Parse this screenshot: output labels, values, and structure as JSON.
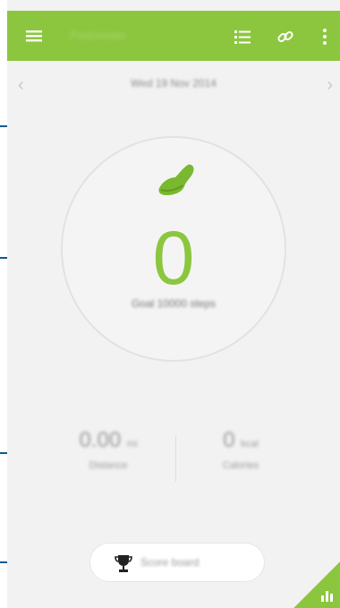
{
  "appbar": {
    "title": "Pedometer",
    "icons": [
      "menu-icon",
      "list-icon",
      "link-icon",
      "more-options-icon"
    ]
  },
  "date_nav": {
    "prev_glyph": "‹",
    "next_glyph": "›",
    "date": "Wed 19 Nov 2014"
  },
  "counter": {
    "steps": "0",
    "goal_text": "Goal 10000 steps"
  },
  "stats": {
    "distance_value": "0.00",
    "distance_unit": "mi",
    "distance_label": "Distance",
    "calories_value": "0",
    "calories_unit": "kcal",
    "calories_label": "Calories"
  },
  "award_button": {
    "label": "Score board"
  },
  "colors": {
    "accent": "#8cc63f",
    "callout": "#0a5c8f",
    "background": "#f2f2f2"
  }
}
